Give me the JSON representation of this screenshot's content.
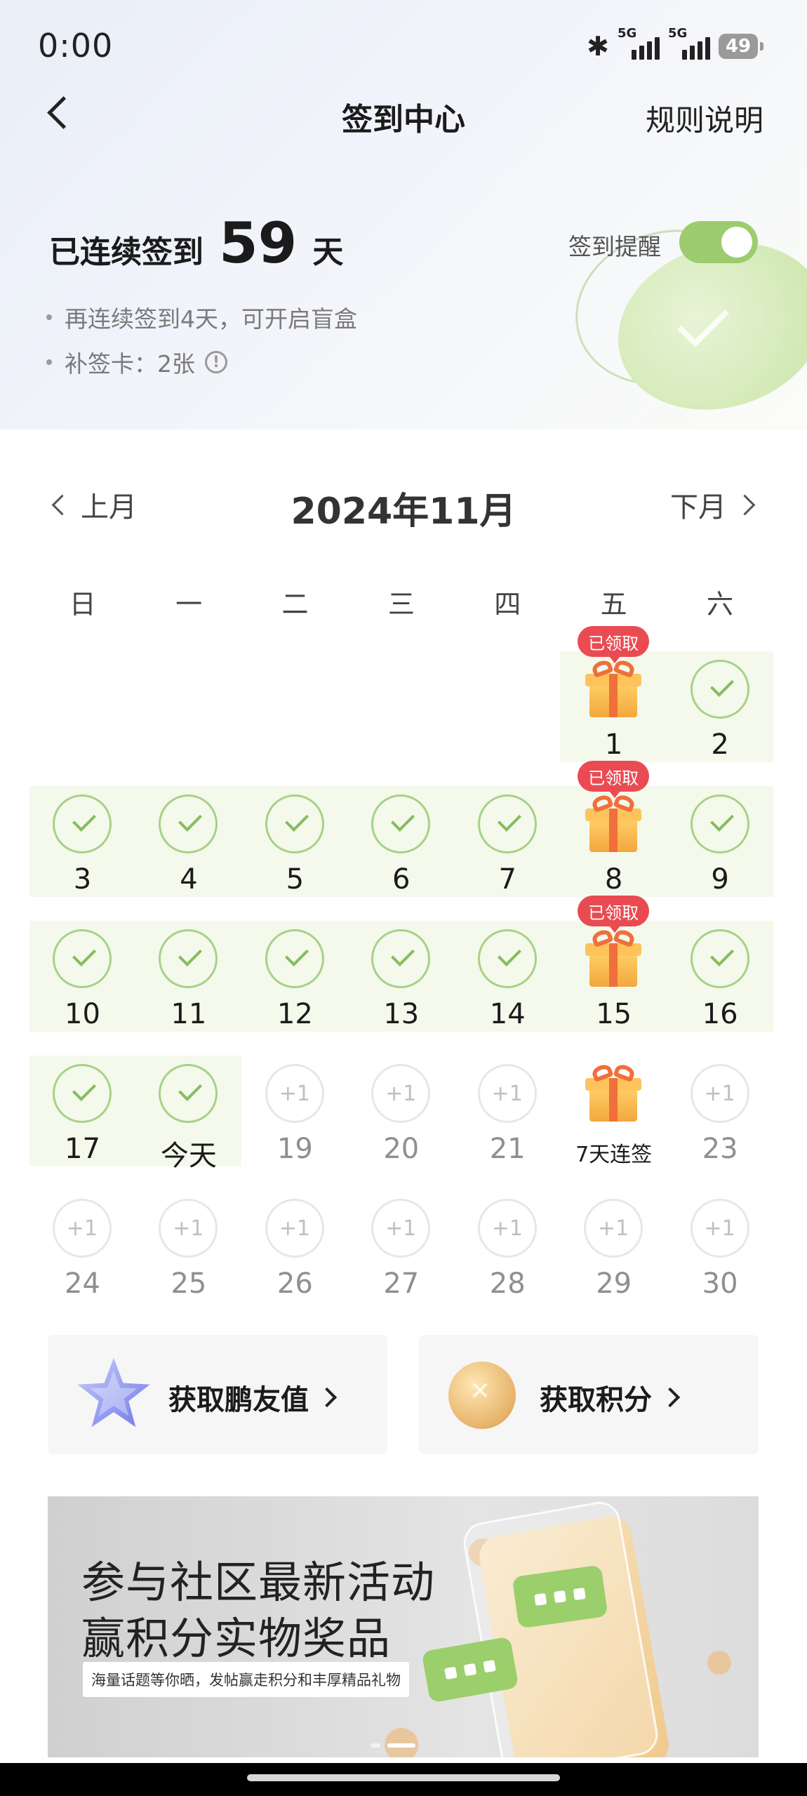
{
  "status": {
    "time": "0:00",
    "network1": "5G",
    "network2": "5G",
    "battery": "49"
  },
  "nav": {
    "title": "签到中心",
    "rules": "规则说明"
  },
  "streak": {
    "prefix": "已连续签到",
    "days": "59",
    "suffix": "天"
  },
  "reminder": {
    "label": "签到提醒",
    "enabled": true
  },
  "info": {
    "line1": "再连续签到4天，可开启盲盒",
    "line2": "补签卡：2张",
    "info_icon": "!"
  },
  "calendar": {
    "prev": "上月",
    "title": "2024年11月",
    "next": "下月",
    "weekdays": [
      "日",
      "一",
      "二",
      "三",
      "四",
      "五",
      "六"
    ],
    "claimed_badge": "已领取",
    "plus_label": "+1",
    "days": [
      {
        "label": "1",
        "state": "gift-claimed"
      },
      {
        "label": "2",
        "state": "checked"
      },
      {
        "label": "3",
        "state": "checked"
      },
      {
        "label": "4",
        "state": "checked"
      },
      {
        "label": "5",
        "state": "checked"
      },
      {
        "label": "6",
        "state": "checked"
      },
      {
        "label": "7",
        "state": "checked"
      },
      {
        "label": "8",
        "state": "gift-claimed"
      },
      {
        "label": "9",
        "state": "checked"
      },
      {
        "label": "10",
        "state": "checked"
      },
      {
        "label": "11",
        "state": "checked"
      },
      {
        "label": "12",
        "state": "checked"
      },
      {
        "label": "13",
        "state": "checked"
      },
      {
        "label": "14",
        "state": "checked"
      },
      {
        "label": "15",
        "state": "gift-claimed"
      },
      {
        "label": "16",
        "state": "checked"
      },
      {
        "label": "17",
        "state": "checked"
      },
      {
        "label": "今天",
        "state": "checked"
      },
      {
        "label": "19",
        "state": "future"
      },
      {
        "label": "20",
        "state": "future"
      },
      {
        "label": "21",
        "state": "future"
      },
      {
        "label": "7天连签",
        "state": "gift-future"
      },
      {
        "label": "23",
        "state": "future"
      },
      {
        "label": "24",
        "state": "future"
      },
      {
        "label": "25",
        "state": "future"
      },
      {
        "label": "26",
        "state": "future"
      },
      {
        "label": "27",
        "state": "future"
      },
      {
        "label": "28",
        "state": "future"
      },
      {
        "label": "29",
        "state": "future"
      },
      {
        "label": "30",
        "state": "future"
      }
    ]
  },
  "actions": {
    "friend_value": "获取鹏友值",
    "points": "获取积分"
  },
  "banner": {
    "line1": "参与社区最新活动",
    "line2": "赢积分实物奖品",
    "sub": "海量话题等你晒，发帖赢走积分和丰厚精品礼物"
  },
  "colors": {
    "accent_green": "#9ccc6d",
    "badge_red": "#ea4b52",
    "check_green": "#a8d185"
  }
}
